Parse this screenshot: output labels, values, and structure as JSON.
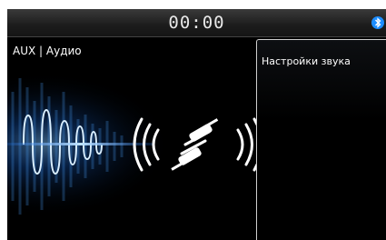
{
  "status_bar": {
    "time": "00:00",
    "bluetooth_icon": "bluetooth-icon"
  },
  "source": {
    "title": "AUX | Аудио"
  },
  "connection_graphic": {
    "icon": "audio-jack-connected-icon"
  },
  "side_panel": {
    "title": "Настройки звука"
  },
  "colors": {
    "accent": "#2e8fff",
    "background": "#000000",
    "panel_border": "#cfcfcf"
  }
}
